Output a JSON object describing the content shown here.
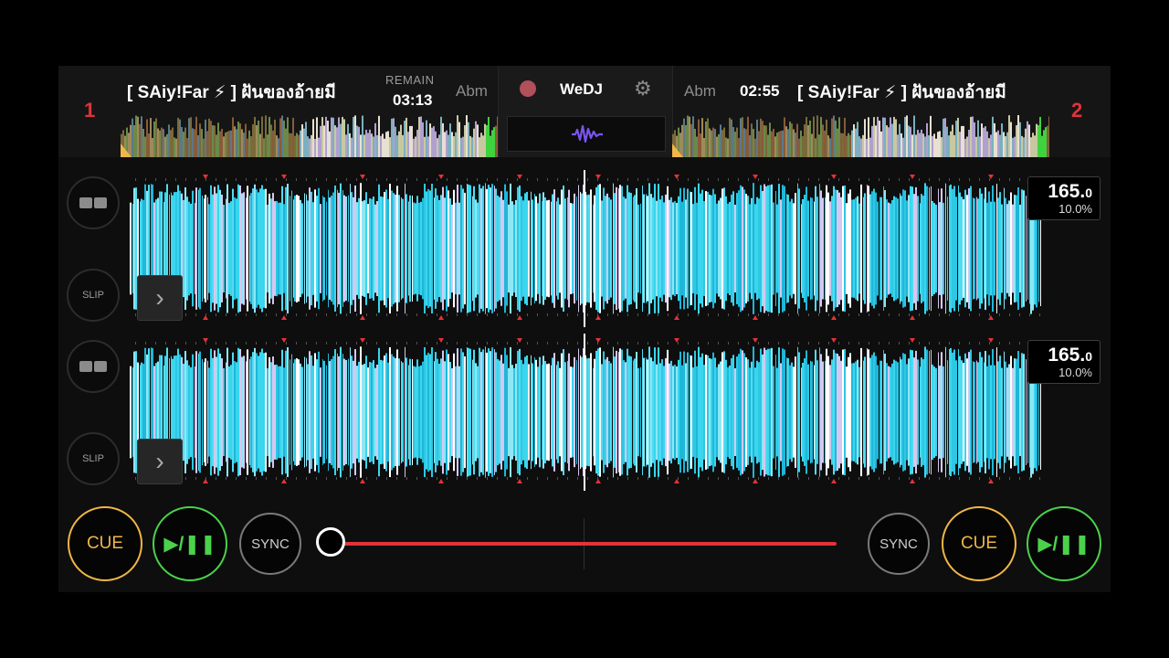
{
  "deck1": {
    "number": "1",
    "title": "[ SAiy!Far ⚡ ] ฝันของอ้ายมี",
    "key": "Abm",
    "remain_label": "REMAIN",
    "remain_time": "03:13"
  },
  "deck2": {
    "number": "2",
    "title": "[ SAiy!Far ⚡ ] ฝันของอ้ายมี",
    "key": "Abm",
    "time": "02:55"
  },
  "center": {
    "logo": "WeDJ",
    "record_icon": "record-icon",
    "settings_icon": "gear-icon",
    "waveform_toggle_icon": "waveform-icon"
  },
  "waveforms": [
    {
      "bpm": "165.",
      "bpm_decimal": "0",
      "pitch": "10.0%",
      "slip_label": "SLIP"
    },
    {
      "bpm": "165.",
      "bpm_decimal": "0",
      "pitch": "10.0%",
      "slip_label": "SLIP"
    }
  ],
  "controls": {
    "left": {
      "cue": "CUE",
      "play": "▶/❚❚",
      "sync": "SYNC"
    },
    "right": {
      "cue": "CUE",
      "play": "▶/❚❚",
      "sync": "SYNC"
    },
    "crossfader_position": 0
  },
  "colors": {
    "accent_red": "#e0333a",
    "cue": "#f0b646",
    "play": "#4bd24b",
    "wave": "#39d6ee"
  }
}
